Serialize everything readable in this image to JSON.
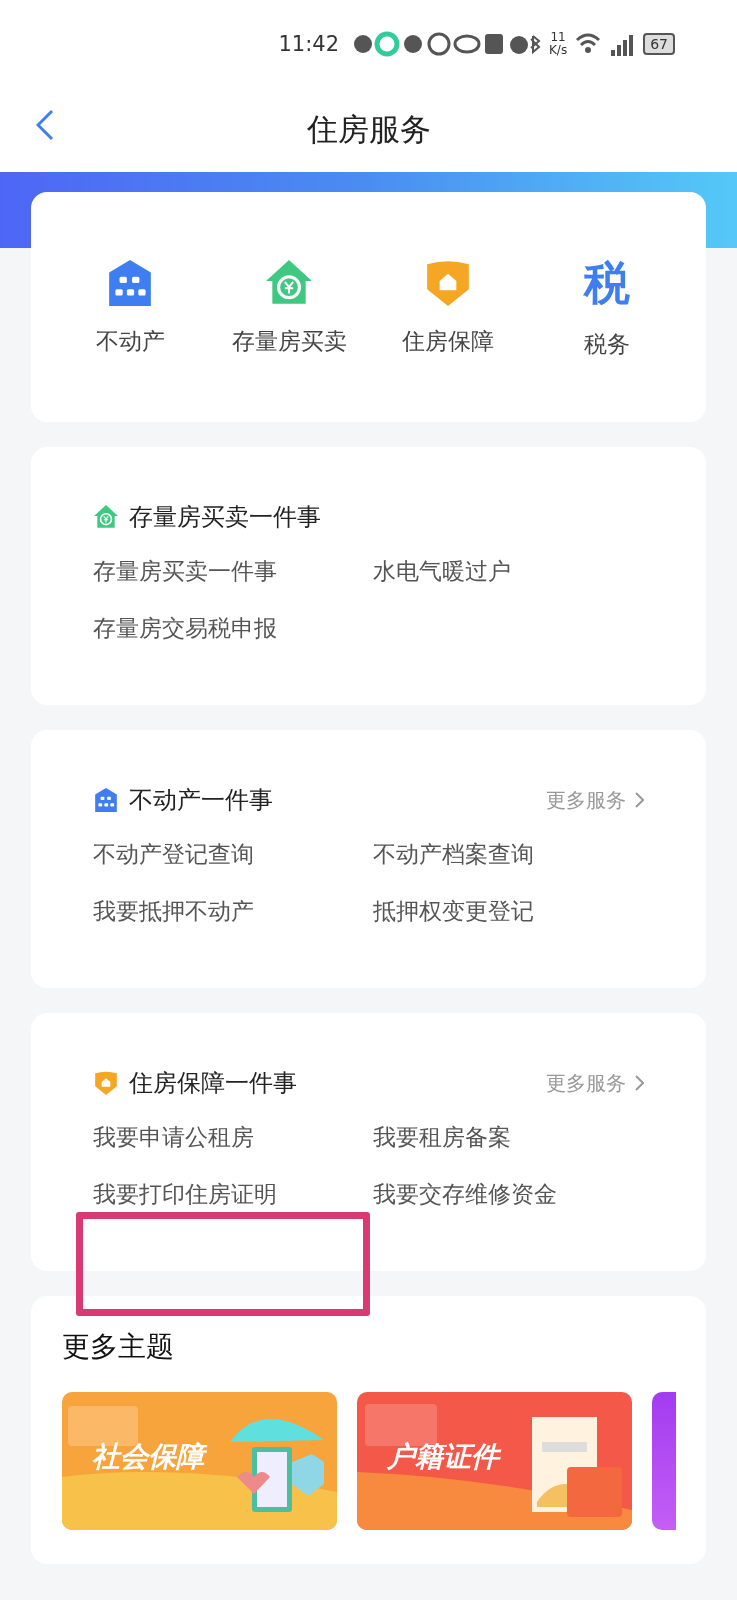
{
  "status_bar": {
    "time": "11:42",
    "speed_value": "11",
    "speed_unit": "K/s",
    "battery": "67"
  },
  "header": {
    "title": "住房服务"
  },
  "categories": [
    {
      "label": "不动产",
      "kind": "building"
    },
    {
      "label": "存量房买卖",
      "kind": "house-yen"
    },
    {
      "label": "住房保障",
      "kind": "shield-house"
    },
    {
      "label": "税务",
      "kind": "glyph",
      "glyph": "税"
    }
  ],
  "sections": [
    {
      "title": "存量房买卖一件事",
      "kind": "house-yen",
      "items": [
        "存量房买卖一件事",
        "水电气暖过户",
        "存量房交易税申报"
      ]
    },
    {
      "title": "不动产一件事",
      "kind": "building",
      "more": "更多服务",
      "items": [
        "不动产登记查询",
        "不动产档案查询",
        "我要抵押不动产",
        "抵押权变更登记"
      ]
    },
    {
      "title": "住房保障一件事",
      "kind": "shield-house",
      "more": "更多服务",
      "items": [
        "我要申请公租房",
        "我要租房备案",
        "我要打印住房证明",
        "我要交存维修资金"
      ]
    }
  ],
  "more_topics": {
    "title": "更多主题",
    "cards": [
      {
        "label": "社会保障",
        "kind": "umbrella"
      },
      {
        "label": "户籍证件",
        "kind": "document"
      },
      {
        "kind": "cut"
      }
    ]
  }
}
